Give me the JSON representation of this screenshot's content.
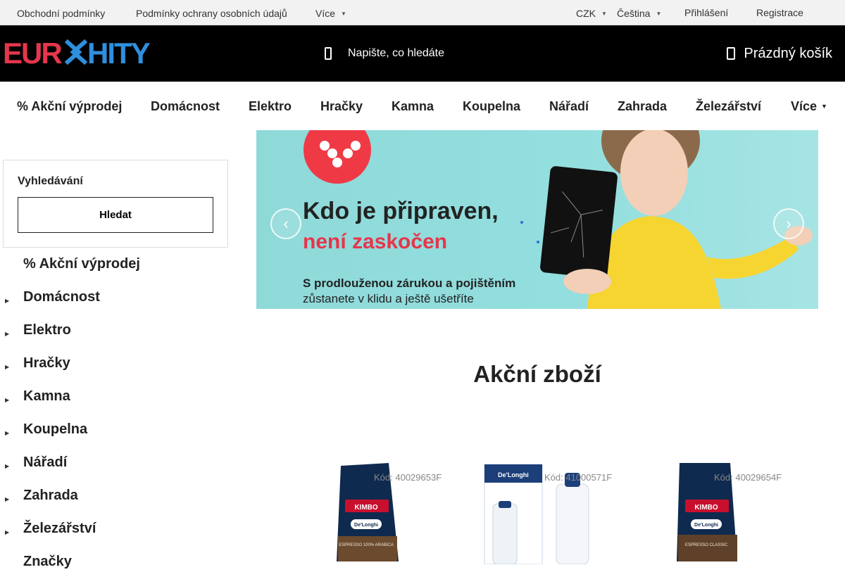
{
  "topbar": {
    "terms": "Obchodní podmínky",
    "privacy": "Podmínky ochrany osobních údajů",
    "more": "Více",
    "currency": "CZK",
    "language": "Čeština",
    "login": "Přihlášení",
    "register": "Registrace"
  },
  "header": {
    "logo_text": "EUROHITY",
    "search_placeholder": "Napište, co hledáte",
    "cart_label": "Prázdný košík"
  },
  "main_nav": [
    "% Akční výprodej",
    "Domácnost",
    "Elektro",
    "Hračky",
    "Kamna",
    "Koupelna",
    "Nářadí",
    "Zahrada",
    "Železářství",
    "Více"
  ],
  "sidebar": {
    "search_title": "Vyhledávání",
    "search_button": "Hledat",
    "categories": [
      "% Akční výprodej",
      "Domácnost",
      "Elektro",
      "Hračky",
      "Kamna",
      "Koupelna",
      "Nářadí",
      "Zahrada",
      "Železářství",
      "Značky"
    ]
  },
  "banner": {
    "headline_1": "Kdo je připraven,",
    "headline_2": "není zaskočen",
    "subline_1": "S prodlouženou zárukou a pojištěním",
    "subline_2": "zůstanete v klidu a ještě ušetříte"
  },
  "section": {
    "title": "Akční zboží"
  },
  "products": [
    {
      "code": "Kód: 40029653F",
      "brand": "KIMBO",
      "sub": "De'Longhi",
      "label": "ESPRESSO 100% ARABICA"
    },
    {
      "code": "Kód: 41000571F",
      "brand": "De'Longhi",
      "sub": "",
      "label": ""
    },
    {
      "code": "Kód: 40029654F",
      "brand": "KIMBO",
      "sub": "De'Longhi",
      "label": "ESPRESSO CLASSIC"
    }
  ],
  "colors": {
    "header_bg": "#000000",
    "logo_red": "#e5364b",
    "logo_blue": "#2e8fde",
    "banner_teal": "#8fd9d9",
    "accent_red": "#e5364b"
  }
}
